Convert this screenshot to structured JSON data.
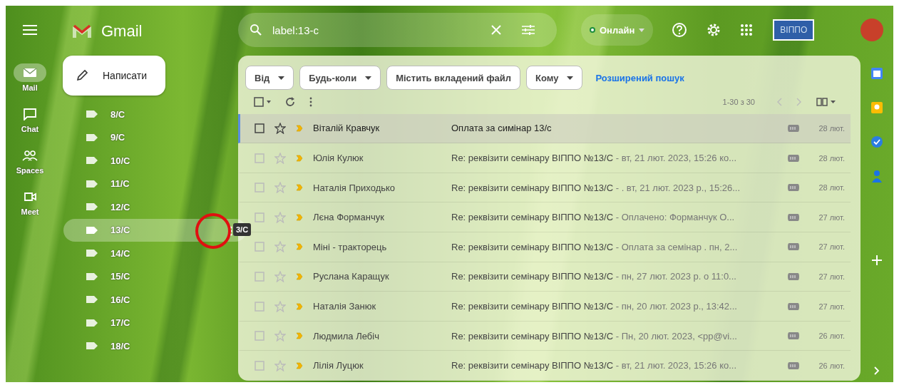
{
  "app": {
    "name": "Gmail"
  },
  "rail": [
    {
      "label": "Mail",
      "kind": "mail",
      "selected": true
    },
    {
      "label": "Chat",
      "kind": "chat",
      "selected": false
    },
    {
      "label": "Spaces",
      "kind": "spaces",
      "selected": false
    },
    {
      "label": "Meet",
      "kind": "meet",
      "selected": false
    }
  ],
  "compose": {
    "label": "Написати"
  },
  "labels": [
    {
      "name": "8/C",
      "selected": false
    },
    {
      "name": "9/C",
      "selected": false
    },
    {
      "name": "10/C",
      "selected": false
    },
    {
      "name": "11/C",
      "selected": false
    },
    {
      "name": "12/C",
      "selected": false
    },
    {
      "name": "13/C",
      "selected": true
    },
    {
      "name": "14/C",
      "selected": false
    },
    {
      "name": "15/C",
      "selected": false
    },
    {
      "name": "16/C",
      "selected": false
    },
    {
      "name": "17/C",
      "selected": false
    },
    {
      "name": "18/C",
      "selected": false
    }
  ],
  "tooltip": "3/C",
  "search": {
    "value": "label:13-c"
  },
  "status": {
    "label": "Онлайн",
    "online": true
  },
  "account": {
    "badge": "ВІППО"
  },
  "filters": [
    {
      "label": "Від",
      "dropdown": true
    },
    {
      "label": "Будь-коли",
      "dropdown": true
    },
    {
      "label": "Містить вкладений файл",
      "dropdown": false
    },
    {
      "label": "Кому",
      "dropdown": true
    }
  ],
  "advanced_search": "Розширений пошук",
  "pagination": "1-30 з 30",
  "emails": [
    {
      "sender": "Віталій Кравчук",
      "subject": "Оплата за симінар 13/с",
      "date": "28 лют.",
      "focused": true,
      "starred": false,
      "important": true
    },
    {
      "sender": "Юлія Кулюк",
      "subject": "Re: реквізити семінару ВІППО №13/С",
      "snippet": " - вт, 21 лют. 2023, 15:26 ко...",
      "date": "28 лют.",
      "focused": false,
      "starred": false,
      "important": true
    },
    {
      "sender": "Наталія Приходько",
      "subject": "Re: реквізити семінару ВІППО №13/С",
      "snippet": " - . вт, 21 лют. 2023 р., 15:26...",
      "date": "28 лют.",
      "focused": false,
      "starred": false,
      "important": true
    },
    {
      "sender": "Лєна Форманчук",
      "subject": "Re: реквізити семінару ВІППО №13/С",
      "snippet": " - Оплачено: Форманчук О...",
      "date": "27 лют.",
      "focused": false,
      "starred": false,
      "important": true
    },
    {
      "sender": "Міні - тракторець",
      "subject": "Re: реквізити семінару ВІППО №13/С",
      "snippet": " - Оплата за семінар . пн, 2...",
      "date": "27 лют.",
      "focused": false,
      "starred": false,
      "important": true
    },
    {
      "sender": "Руслана Каращук",
      "subject": "Re: реквізити семінару ВІППО №13/С",
      "snippet": " - пн, 27 лют. 2023 р. о 11:0...",
      "date": "27 лют.",
      "focused": false,
      "starred": false,
      "important": true
    },
    {
      "sender": "Наталія Занюк",
      "subject": "Re: реквізити семінару ВІППО №13/С",
      "snippet": " - пн, 20 лют. 2023 р., 13:42...",
      "date": "27 лют.",
      "focused": false,
      "starred": false,
      "important": true
    },
    {
      "sender": "Людмила Лебіч",
      "subject": "Re: реквізити семінару ВІППО №13/С",
      "snippet": " - Пн, 20 лют. 2023, <pp@vi...",
      "date": "26 лют.",
      "focused": false,
      "starred": false,
      "important": true
    },
    {
      "sender": "Лілія Луцюк",
      "subject": "Re: реквізити семінару ВІППО №13/С",
      "snippet": " - вт, 21 лют. 2023, 15:26 ко...",
      "date": "26 лют.",
      "focused": false,
      "starred": false,
      "important": true
    }
  ],
  "side_apps": [
    {
      "kind": "calendar"
    },
    {
      "kind": "keep"
    },
    {
      "kind": "tasks"
    },
    {
      "kind": "contacts"
    }
  ]
}
